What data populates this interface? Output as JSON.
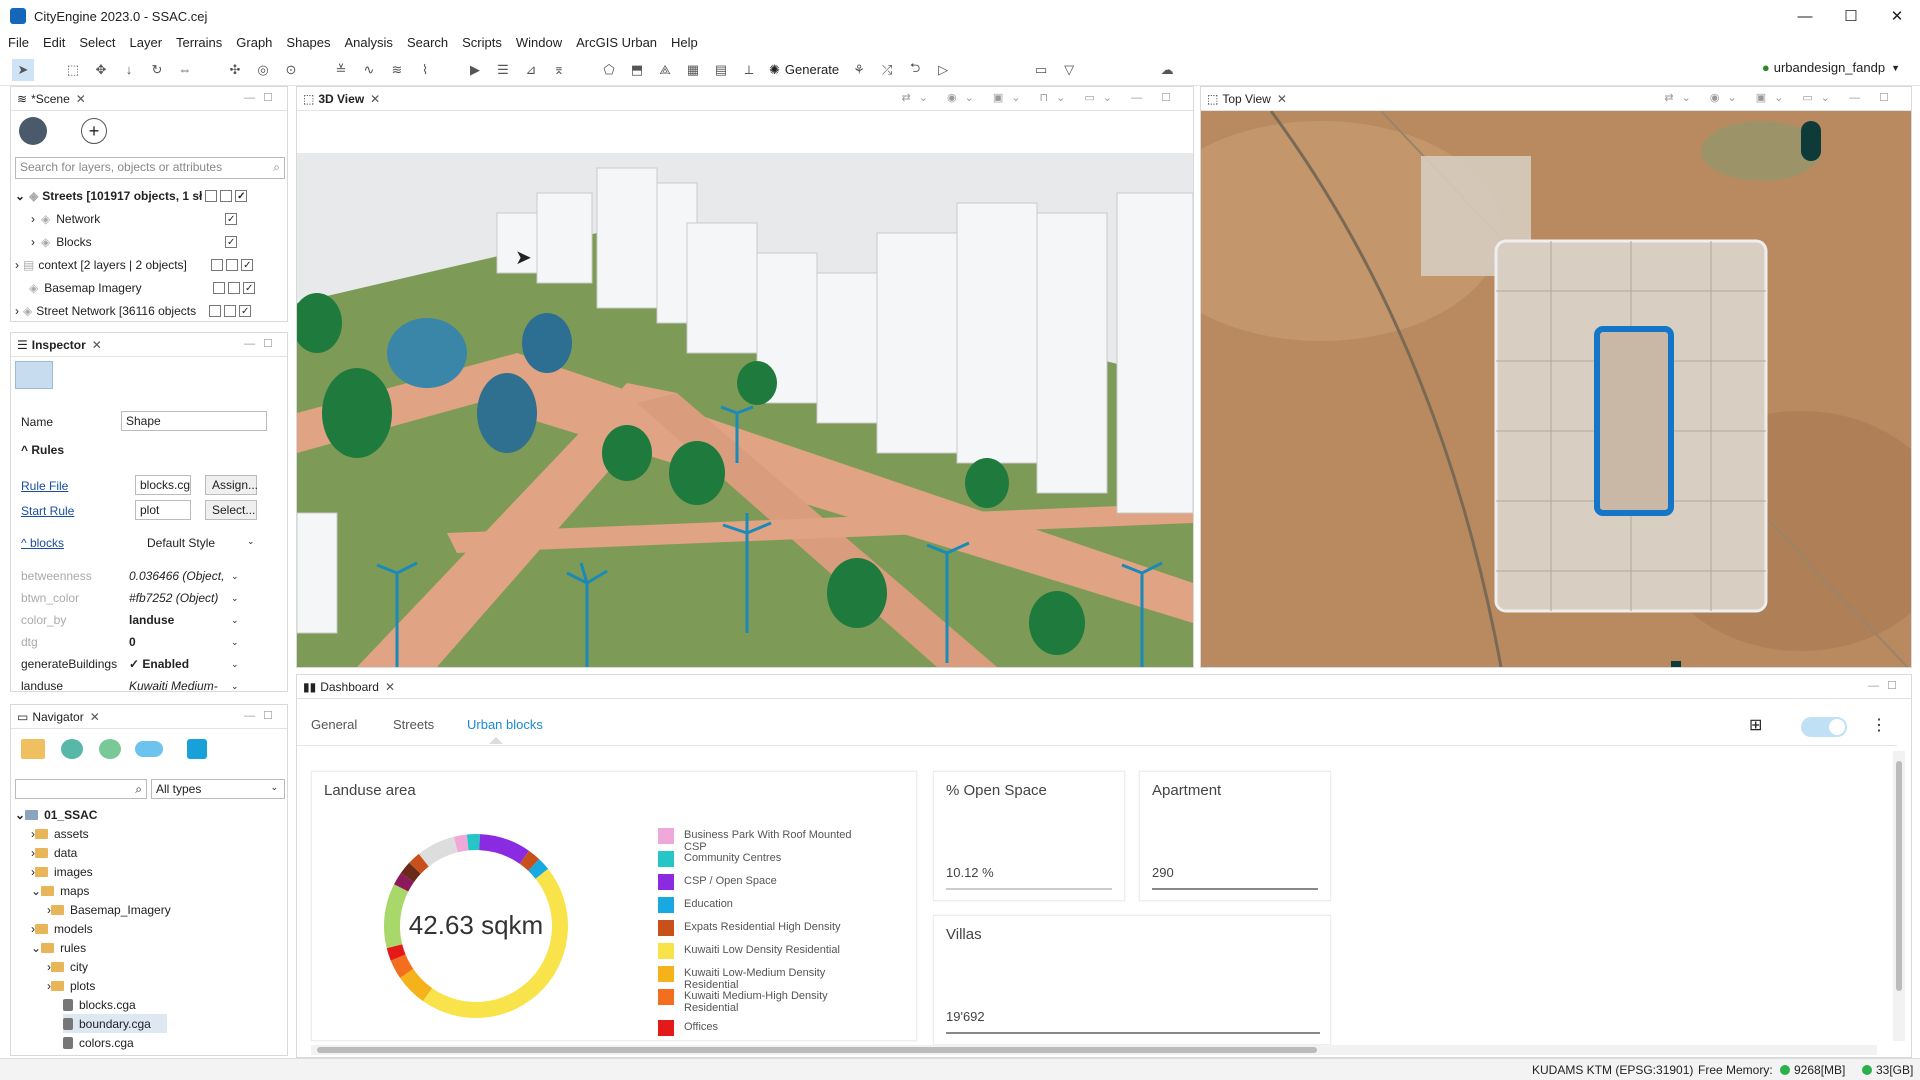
{
  "window": {
    "title": "CityEngine 2023.0 - SSAC.cej",
    "controls": [
      "—",
      "☐",
      "✕"
    ]
  },
  "menu": [
    "File",
    "Edit",
    "Select",
    "Layer",
    "Terrains",
    "Graph",
    "Shapes",
    "Analysis",
    "Search",
    "Scripts",
    "Window",
    "ArcGIS Urban",
    "Help"
  ],
  "toolbar": {
    "generate_label": "Generate",
    "user": "urbandesign_fandp"
  },
  "scene": {
    "tab": "*Scene",
    "search_placeholder": "Search for layers, objects or attributes",
    "layers": [
      {
        "label": "Streets [101917 objects, 1 sł",
        "bold": true
      },
      {
        "label": "Network"
      },
      {
        "label": "Blocks"
      },
      {
        "label": "context [2 layers | 2 objects]"
      },
      {
        "label": "Basemap Imagery"
      },
      {
        "label": "Street Network [36116 objects"
      }
    ]
  },
  "inspector": {
    "tab": "Inspector",
    "name_label": "Name",
    "name_value": "Shape",
    "rules_heading": "Rules",
    "rule_file_label": "Rule File",
    "rule_file_value": "blocks.cg",
    "assign_btn": "Assign...",
    "start_rule_label": "Start Rule",
    "start_rule_value": "plot",
    "select_btn": "Select...",
    "blocks_label": "blocks",
    "blocks_style": "Default Style",
    "attrs": [
      {
        "name": "betweenness",
        "value": "0.036466 (Object,",
        "grey": true
      },
      {
        "name": "btwn_color",
        "value": "#fb7252 (Object)",
        "grey": true
      },
      {
        "name": "color_by",
        "value": "landuse",
        "grey": true
      },
      {
        "name": "dtg",
        "value": "0",
        "grey": true
      },
      {
        "name": "generateBuildings",
        "value": "✓ Enabled",
        "grey": false
      },
      {
        "name": "landuse",
        "value": "Kuwaiti Medium-",
        "grey": false
      }
    ]
  },
  "navigator": {
    "tab": "Navigator",
    "filter": "All types",
    "tree": [
      {
        "label": "01_SSAC",
        "level": 0,
        "type": "project"
      },
      {
        "label": "assets",
        "level": 1,
        "type": "folder"
      },
      {
        "label": "data",
        "level": 1,
        "type": "folder"
      },
      {
        "label": "images",
        "level": 1,
        "type": "folder"
      },
      {
        "label": "maps",
        "level": 1,
        "type": "folder"
      },
      {
        "label": "Basemap_Imagery",
        "level": 2,
        "type": "folder"
      },
      {
        "label": "models",
        "level": 1,
        "type": "folder"
      },
      {
        "label": "rules",
        "level": 1,
        "type": "folder"
      },
      {
        "label": "city",
        "level": 2,
        "type": "folder"
      },
      {
        "label": "plots",
        "level": 2,
        "type": "folder"
      },
      {
        "label": "blocks.cga",
        "level": 2,
        "type": "file"
      },
      {
        "label": "boundary.cga",
        "level": 2,
        "type": "file"
      },
      {
        "label": "colors.cga",
        "level": 2,
        "type": "file"
      }
    ]
  },
  "views": {
    "view3d_tab": "3D View",
    "top_tab": "Top View"
  },
  "dashboard": {
    "tab": "Dashboard",
    "subtabs": [
      "General",
      "Streets",
      "Urban blocks"
    ],
    "active_subtab": "Urban blocks",
    "landuse_title": "Landuse area",
    "landuse_total": "42.63 sqkm",
    "open_space_title": "% Open Space",
    "open_space_value": "10.12 %",
    "apartment_title": "Apartment",
    "apartment_value": "290",
    "villas_title": "Villas",
    "villas_value": "19'692"
  },
  "chart_data": {
    "type": "pie",
    "title": "Landuse area",
    "center_label": "42.63 sqkm",
    "legend": [
      {
        "name": "Business Park With Roof Mounted CSP",
        "color": "#f0a8d8"
      },
      {
        "name": "Community Centres",
        "color": "#26c6c6"
      },
      {
        "name": "CSP / Open Space",
        "color": "#8a2be2"
      },
      {
        "name": "Education",
        "color": "#17a9e0"
      },
      {
        "name": "Expats Residential High Density",
        "color": "#c8501a"
      },
      {
        "name": "Kuwaiti Low Density Residential",
        "color": "#f8e44a"
      },
      {
        "name": "Kuwaiti Low-Medium Density Residential",
        "color": "#f6b21a"
      },
      {
        "name": "Kuwaiti Medium-High Density Residential",
        "color": "#f36f1f"
      },
      {
        "name": "Offices",
        "color": "#e41a1a"
      }
    ],
    "slices": [
      {
        "color": "#f8e44a",
        "value": 40
      },
      {
        "color": "#f6b21a",
        "value": 5
      },
      {
        "color": "#f36f1f",
        "value": 3
      },
      {
        "color": "#e41a1a",
        "value": 2
      },
      {
        "color": "#a8d86a",
        "value": 10
      },
      {
        "color": "#8b1a5a",
        "value": 2
      },
      {
        "color": "#6a2a1a",
        "value": 2
      },
      {
        "color": "#c8501a",
        "value": 2
      },
      {
        "color": "#dddddd",
        "value": 6
      },
      {
        "color": "#f0a8d8",
        "value": 2
      },
      {
        "color": "#26c6c6",
        "value": 2
      },
      {
        "color": "#8a2be2",
        "value": 8
      },
      {
        "color": "#c8501a",
        "value": 2
      },
      {
        "color": "#17a9e0",
        "value": 2
      }
    ]
  },
  "status": {
    "crs": "KUDAMS KTM (EPSG:31901)",
    "mem_label": "Free Memory:",
    "mem1": "9268[MB]",
    "mem2": "33[GB]"
  }
}
